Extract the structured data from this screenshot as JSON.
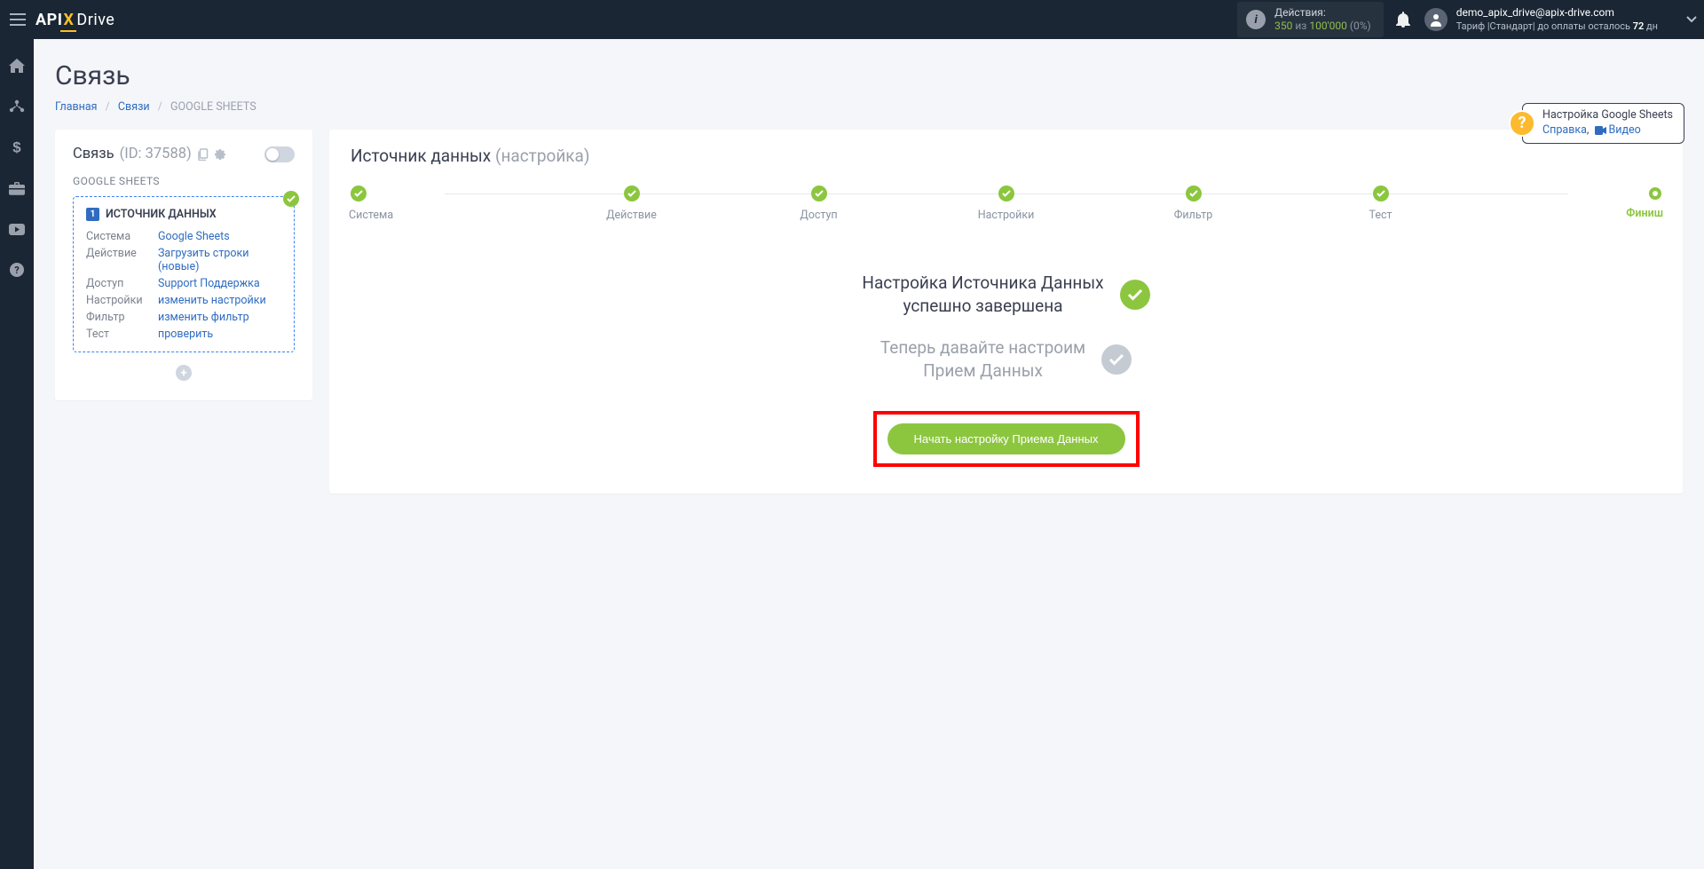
{
  "nav": {
    "actions_label": "Действия:",
    "actions_count": "350",
    "actions_of": " из ",
    "actions_limit": "100'000",
    "actions_pct": " (0%)",
    "user_email": "demo_apix_drive@apix-drive.com",
    "tariff_prefix": "Тариф |Стандарт| до оплаты осталось ",
    "tariff_days": "72",
    "tariff_suffix": " дн"
  },
  "page": {
    "title": "Связь",
    "crumb_home": "Главная",
    "crumb_links": "Связи",
    "crumb_current": "GOOGLE SHEETS"
  },
  "help": {
    "title": "Настройка Google Sheets",
    "help_link": "Справка",
    "sep": ",",
    "video_link": "Видео"
  },
  "left": {
    "title": "Связь",
    "id_label": "(ID: 37588)",
    "subtitle": "GOOGLE SHEETS",
    "source_title": "ИСТОЧНИК ДАННЫХ",
    "rows": [
      {
        "k": "Система",
        "v": "Google Sheets"
      },
      {
        "k": "Действие",
        "v": "Загрузить строки (новые)"
      },
      {
        "k": "Доступ",
        "v": "Support Поддержка"
      },
      {
        "k": "Настройки",
        "v": "изменить настройки"
      },
      {
        "k": "Фильтр",
        "v": "изменить фильтр"
      },
      {
        "k": "Тест",
        "v": "проверить"
      }
    ]
  },
  "right": {
    "title": "Источник данных",
    "title_suffix": "(настройка)",
    "steps": [
      "Система",
      "Действие",
      "Доступ",
      "Настройки",
      "Фильтр",
      "Тест",
      "Финиш"
    ],
    "done_line1": "Настройка Источника Данных",
    "done_line2": "успешно завершена",
    "pending_line1": "Теперь давайте настроим",
    "pending_line2": "Прием Данных",
    "cta": "Начать настройку Приема Данных"
  }
}
